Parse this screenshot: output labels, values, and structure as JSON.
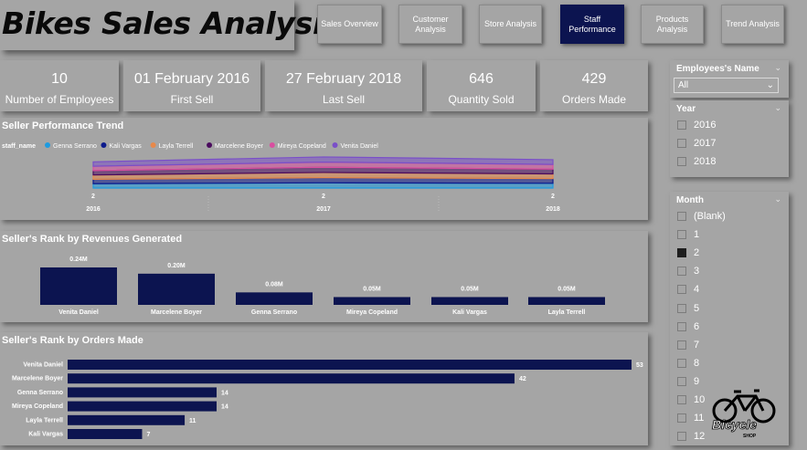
{
  "page_title": "Bikes Sales Analysis",
  "nav": [
    {
      "label": "Sales Overview",
      "active": false
    },
    {
      "label": "Customer Analysis",
      "active": false
    },
    {
      "label": "Store Analysis",
      "active": false
    },
    {
      "label": "Staff Performance",
      "active": true
    },
    {
      "label": "Products Analysis",
      "active": false
    },
    {
      "label": "Trend Analysis",
      "active": false
    }
  ],
  "kpis": [
    {
      "value": "10",
      "label": "Number of Employees"
    },
    {
      "value": "01 February 2016",
      "label": "First Sell"
    },
    {
      "value": "27 February 2018",
      "label": "Last Sell"
    },
    {
      "value": "646",
      "label": "Quantity Sold"
    },
    {
      "value": "429",
      "label": "Orders Made"
    }
  ],
  "colors": {
    "navy": "#0c1450",
    "background": "#a5a5a5",
    "series": [
      "#1e9be0",
      "#0c1a8c",
      "#e8894a",
      "#4a0a5e",
      "#d94fa0",
      "#7a4fc8"
    ]
  },
  "slicers": {
    "employee": {
      "title": "Employees's Name",
      "selected": "All"
    },
    "year": {
      "title": "Year",
      "options": [
        "2016",
        "2017",
        "2018"
      ]
    },
    "month": {
      "title": "Month",
      "options": [
        "(Blank)",
        "1",
        "2",
        "3",
        "4",
        "5",
        "6",
        "7",
        "8",
        "9",
        "10",
        "11",
        "12"
      ],
      "selected": "2"
    }
  },
  "logo": {
    "text": "Bicycle",
    "subtext": "SHOP"
  },
  "chart_data": [
    {
      "type": "area",
      "title": "Seller Performance Trend",
      "legend_title": "staff_name",
      "legend_position": "top-left",
      "x": [
        "2016",
        "2017",
        "2018"
      ],
      "point_labels": [
        "2",
        "2",
        "2"
      ],
      "series": [
        {
          "name": "Genna Serrano",
          "values": [
            2,
            2,
            2
          ]
        },
        {
          "name": "Kali Vargas",
          "values": [
            2,
            2,
            2
          ]
        },
        {
          "name": "Layla Terrell",
          "values": [
            2,
            2,
            2
          ]
        },
        {
          "name": "Marcelene Boyer",
          "values": [
            2,
            2,
            2
          ]
        },
        {
          "name": "Mireya Copeland",
          "values": [
            2,
            2,
            2
          ]
        },
        {
          "name": "Venita Daniel",
          "values": [
            2,
            2,
            2
          ]
        }
      ]
    },
    {
      "type": "bar",
      "title": "Seller's Rank by Revenues Generated",
      "categories": [
        "Venita Daniel",
        "Marcelene Boyer",
        "Genna Serrano",
        "Mireya Copeland",
        "Kali Vargas",
        "Layla Terrell"
      ],
      "values": [
        0.24,
        0.2,
        0.08,
        0.05,
        0.05,
        0.05
      ],
      "value_labels": [
        "0.24M",
        "0.20M",
        "0.08M",
        "0.05M",
        "0.05M",
        "0.05M"
      ],
      "unit": "M"
    },
    {
      "type": "bar",
      "orientation": "horizontal",
      "title": "Seller's Rank by Orders Made",
      "categories": [
        "Venita Daniel",
        "Marcelene Boyer",
        "Genna Serrano",
        "Mireya Copeland",
        "Layla Terrell",
        "Kali Vargas"
      ],
      "values": [
        53,
        42,
        14,
        14,
        11,
        7
      ]
    }
  ]
}
